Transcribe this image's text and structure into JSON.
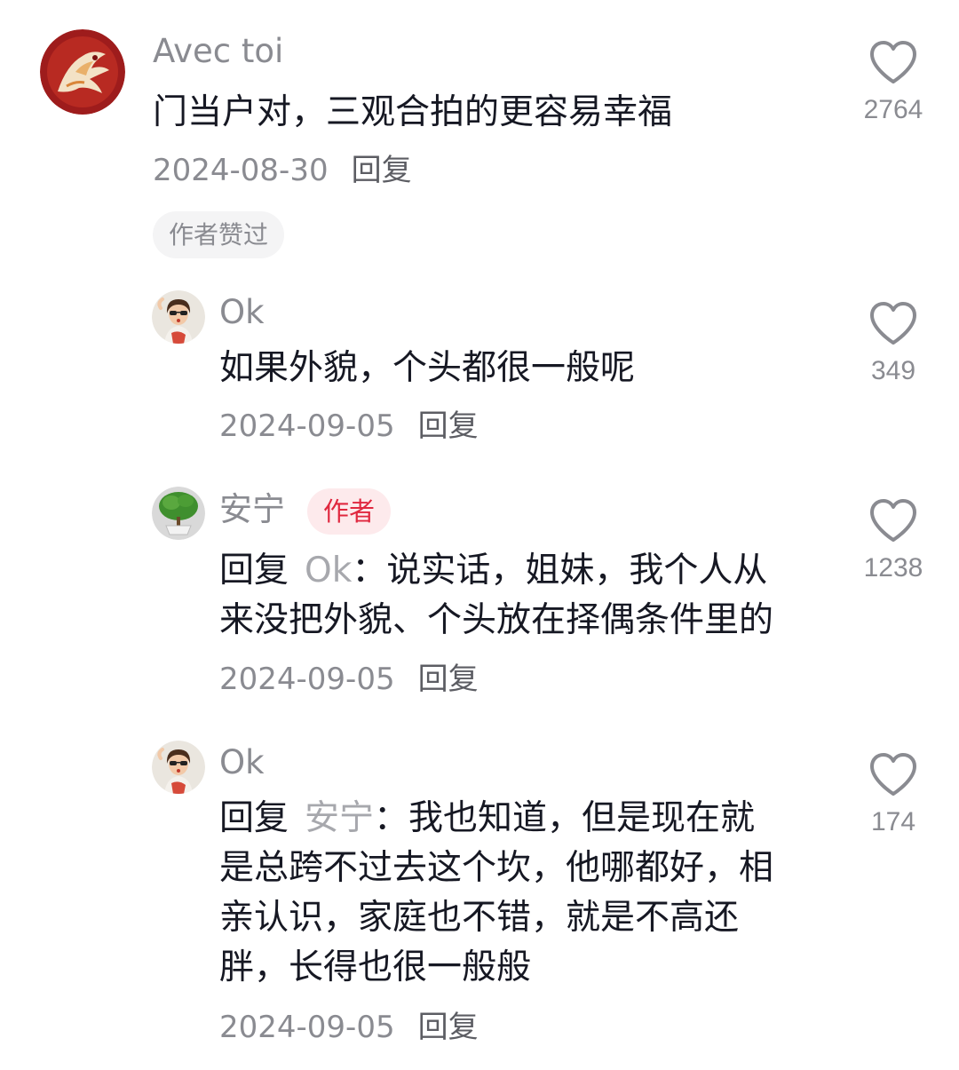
{
  "comments": [
    {
      "username": "Avec toi",
      "text": "门当户对，三观合拍的更容易幸福",
      "date": "2024-08-30",
      "reply_label": "回复",
      "liked_by_author_label": "作者赞过",
      "likes": "2764",
      "avatar_icon": "phoenix-avatar"
    },
    {
      "username": "Ok",
      "text": "如果外貌，个头都很一般呢",
      "date": "2024-09-05",
      "reply_label": "回复",
      "likes": "349",
      "avatar_icon": "girl-sunglasses-avatar"
    },
    {
      "username": "安宁",
      "author_badge": "作者",
      "reply_prefix": "回复",
      "reply_target": "Ok",
      "reply_colon": "：",
      "text_line1": "说实话，姐妹，我个人从",
      "text_line2": "来没把外貌、个头放在择偶条件里的",
      "date": "2024-09-05",
      "reply_label": "回复",
      "likes": "1238",
      "avatar_icon": "bonsai-tree-avatar"
    },
    {
      "username": "Ok",
      "reply_prefix": "回复",
      "reply_target": "安宁",
      "reply_colon": "：",
      "text_line1": "我也知道，但是现在就",
      "text_line2": "是总跨不过去这个坎，他哪都好，相",
      "text_line3": "亲认识，家庭也不错，就是不高还",
      "text_line4": "胖，长得也很一般般",
      "date": "2024-09-05",
      "reply_label": "回复",
      "likes": "174",
      "avatar_icon": "girl-sunglasses-avatar"
    }
  ],
  "colors": {
    "username": "#8a8b91",
    "text": "#161823",
    "author_badge_bg": "#fdeaec",
    "author_badge_text": "#e0283f",
    "heart_outline": "#8a8b91"
  }
}
